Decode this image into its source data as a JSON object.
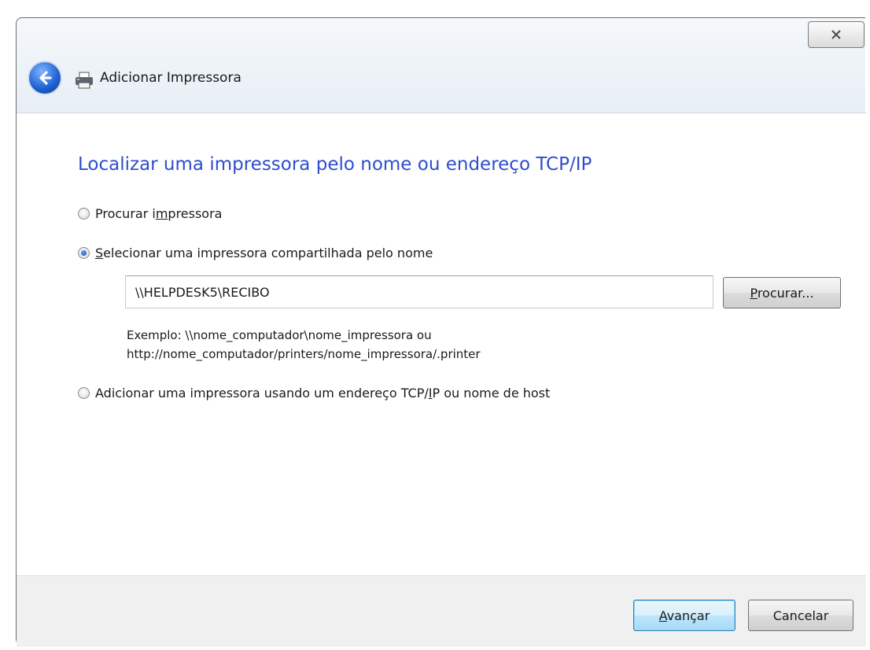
{
  "window": {
    "title": "Adicionar Impressora",
    "close_glyph": "✕"
  },
  "icons": {
    "back": "back-arrow-icon",
    "printer": "printer-icon",
    "close": "close-icon"
  },
  "main": {
    "heading": "Localizar uma impressora pelo nome ou endereço TCP/IP",
    "options": [
      {
        "pre": "Procurar i",
        "key": "m",
        "post": "pressora",
        "selected": false
      },
      {
        "pre": "",
        "key": "S",
        "post": "elecionar uma impressora compartilhada pelo nome",
        "selected": true
      },
      {
        "pre": "Adicionar uma impressora usando um endereço TCP/",
        "key": "I",
        "post": "P ou nome de host",
        "selected": false
      }
    ],
    "printer_name_value": "\\\\HELPDESK5\\RECIBO",
    "browse_button": {
      "key": "P",
      "post": "rocurar..."
    },
    "example_line1": "Exemplo: \\\\nome_computador\\nome_impressora ou",
    "example_line2": "http://nome_computador/printers/nome_impressora/.printer"
  },
  "footer": {
    "next_button": {
      "key": "A",
      "post": "vançar"
    },
    "cancel_button": "Cancelar"
  },
  "colors": {
    "heading": "#2f4dcf",
    "default_button_border": "#3c7fb1"
  }
}
